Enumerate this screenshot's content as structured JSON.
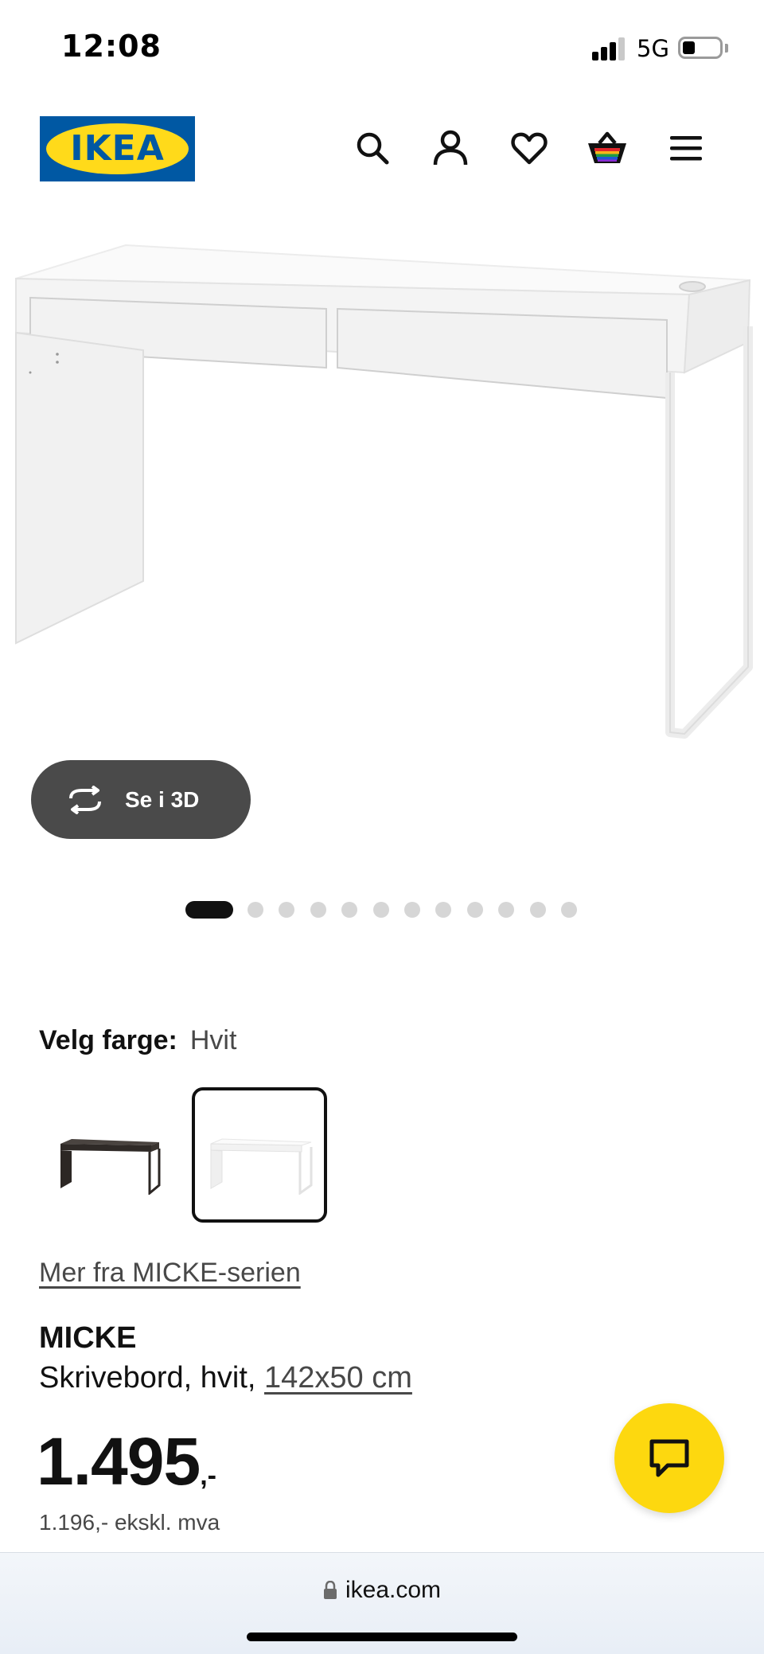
{
  "status_bar": {
    "time": "12:08",
    "network": "5G",
    "signal_bars": 3,
    "battery_level": 0.25
  },
  "header": {
    "logo_text": "IKEA",
    "icons": [
      "search-icon",
      "account-icon",
      "heart-icon",
      "basket-icon",
      "menu-icon"
    ]
  },
  "gallery": {
    "view_3d_label": "Se i 3D",
    "image_count": 13,
    "active_index": 0
  },
  "color": {
    "label": "Velg farge:",
    "selected": "Hvit",
    "options": [
      {
        "name": "black-brown",
        "color": "#3a3330",
        "selected": false
      },
      {
        "name": "white",
        "color": "#ffffff",
        "selected": true
      }
    ]
  },
  "series_link": "Mer fra MICKE-serien",
  "product": {
    "name": "MICKE",
    "description": "Skrivebord, hvit,",
    "measurement": "142x50 cm",
    "price_main": "1.495",
    "price_suffix": ",-",
    "price_ex_vat": "1.196,- ekskl. mva"
  },
  "browser": {
    "url": "ikea.com"
  },
  "colors": {
    "brand_blue": "#0058a3",
    "brand_yellow": "#ffda1a",
    "chat_yellow": "#fdd80f",
    "dark_button": "#4a4a4a"
  }
}
